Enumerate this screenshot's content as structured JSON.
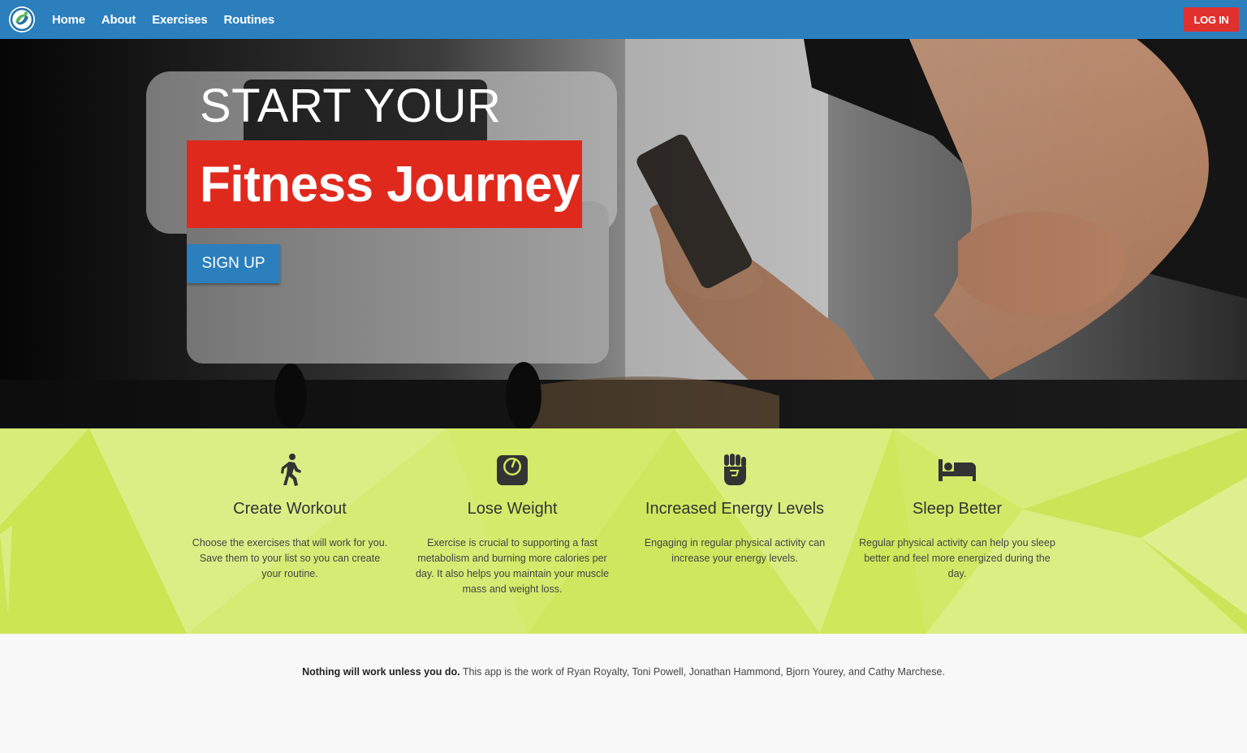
{
  "nav": {
    "links": [
      "Home",
      "About",
      "Exercises",
      "Routines"
    ],
    "login_label": "LOG IN"
  },
  "hero": {
    "line1": "START YOUR",
    "line2": "Fitness Journey",
    "signup_label": "SIGN UP"
  },
  "features": [
    {
      "icon": "walking-icon",
      "title": "Create Workout",
      "text": "Choose the exercises that will work for you. Save them to your list so you can create your routine."
    },
    {
      "icon": "scale-icon",
      "title": "Lose Weight",
      "text": "Exercise is crucial to supporting a fast metabolism and burning more calories per day. It also helps you maintain your muscle mass and weight loss."
    },
    {
      "icon": "fist-icon",
      "title": "Increased Energy Levels",
      "text": "Engaging in regular physical activity can increase your energy levels."
    },
    {
      "icon": "bed-icon",
      "title": "Sleep Better",
      "text": "Regular physical activity can help you sleep better and feel more energized during the day."
    }
  ],
  "footer": {
    "motto": "Nothing will work unless you do.",
    "credits": "This app is the work of Ryan Royalty, Toni Powell, Jonathan Hammond, Bjorn Yourey, and Cathy Marchese."
  },
  "colors": {
    "nav_blue": "#2b7fbd",
    "accent_red": "#e0291d",
    "feature_green": "#cfe75a"
  }
}
